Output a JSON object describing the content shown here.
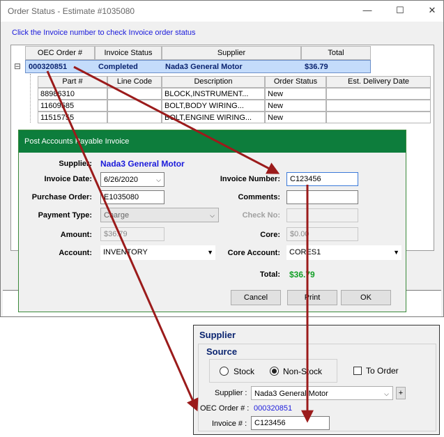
{
  "window": {
    "title": "Order Status - Estimate #1035080",
    "hint": "Click the Invoice number to check Invoice order status",
    "controls": {
      "minimize": "—",
      "maximize": "☐",
      "close": "✕"
    }
  },
  "grid": {
    "expander": "⊟",
    "columns": [
      "OEC Order #",
      "Invoice Status",
      "Supplier",
      "Total"
    ],
    "row": {
      "oec_order": "000320851",
      "status": "Completed",
      "supplier": "Nada3 General Motor",
      "total": "$36.79"
    },
    "detail_columns": [
      "Part #",
      "Line Code",
      "Description",
      "Order Status",
      "Est. Delivery Date"
    ],
    "detail_rows": [
      {
        "part": "88986310",
        "line_code": "",
        "description": "BLOCK,INSTRUMENT...",
        "status": "New",
        "delivery": ""
      },
      {
        "part": "11609585",
        "line_code": "",
        "description": "BOLT,BODY WIRING...",
        "status": "New",
        "delivery": ""
      },
      {
        "part": "11515755",
        "line_code": "",
        "description": "BOLT,ENGINE WIRING...",
        "status": "New",
        "delivery": ""
      }
    ]
  },
  "post_dialog": {
    "title": "Post Accounts Payable Invoice",
    "supplier_label": "Supplier:",
    "supplier_value": "Nada3  General Motor",
    "invoice_date_label": "Invoice Date:",
    "invoice_date_value": "6/26/2020",
    "purchase_order_label": "Purchase Order:",
    "purchase_order_value": "E1035080",
    "payment_type_label": "Payment Type:",
    "payment_type_value": "Charge",
    "amount_label": "Amount:",
    "amount_value": "$36.79",
    "account_label": "Account:",
    "account_value": "INVENTORY",
    "invoice_number_label": "Invoice Number:",
    "invoice_number_value": "C123456",
    "comments_label": "Comments:",
    "comments_value": "",
    "check_no_label": "Check No:",
    "check_no_value": "",
    "core_label": "Core:",
    "core_value": "$0.00",
    "core_account_label": "Core Account:",
    "core_account_value": "CORES1",
    "total_label": "Total:",
    "total_value": "$36.79",
    "cancel_label": "Cancel",
    "print_label": "Print",
    "ok_label": "OK"
  },
  "supplier_panel": {
    "title": "Supplier",
    "source_title": "Source",
    "stock_label": "Stock",
    "nonstock_label": "Non-Stock",
    "selected_source": "Non-Stock",
    "to_order_label": "To Order",
    "supplier_label": "Supplier :",
    "supplier_value": "Nada3  General Motor",
    "plus_label": "+",
    "oec_order_label": "OEC Order # :",
    "oec_order_value": "000320851",
    "invoice_label": "Invoice # :",
    "invoice_value": "C123456"
  },
  "colors": {
    "dialog_title_bg": "#0d7d3c",
    "link_blue": "#1a1adb",
    "total_green": "#14a028",
    "arrow": "#9b1b1b",
    "selected_row": "#c4dcfb"
  },
  "icons": {
    "dropdown": "chevron-down-icon",
    "expander": "collapse-minus-icon"
  }
}
